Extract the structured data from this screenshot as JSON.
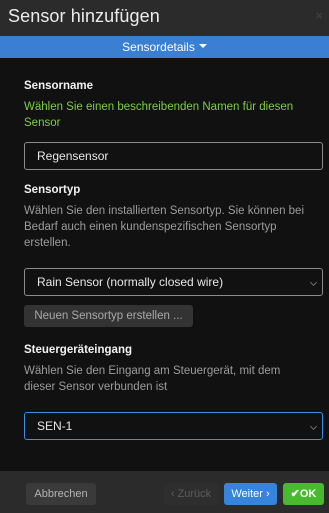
{
  "dialog": {
    "title": "Sensor hinzufügen",
    "close_icon": "×"
  },
  "tab": {
    "label": "Sensordetails"
  },
  "name_section": {
    "heading": "Sensorname",
    "description": "Wählen Sie einen beschreibenden Namen für diesen Sensor",
    "value": "Regensensor"
  },
  "type_section": {
    "heading": "Sensortyp",
    "description": "Wählen Sie den installierten Sensortyp. Sie können bei Bedarf auch einen kundenspezifischen Sensortyp erstellen.",
    "selected": "Rain Sensor (normally closed wire)",
    "new_type_button": "Neuen Sensortyp erstellen ..."
  },
  "input_section": {
    "heading": "Steuergeräteingang",
    "description": "Wählen Sie den Eingang am Steuergerät, mit dem dieser Sensor verbunden ist",
    "selected": "SEN-1"
  },
  "footer": {
    "cancel": "Abbrechen",
    "back": "‹ Zurück",
    "next": "Weiter ›",
    "ok": "✔OK"
  },
  "colors": {
    "accent": "#3a7fd2",
    "success": "#49b92f",
    "hint_green": "#7fcd4a"
  }
}
